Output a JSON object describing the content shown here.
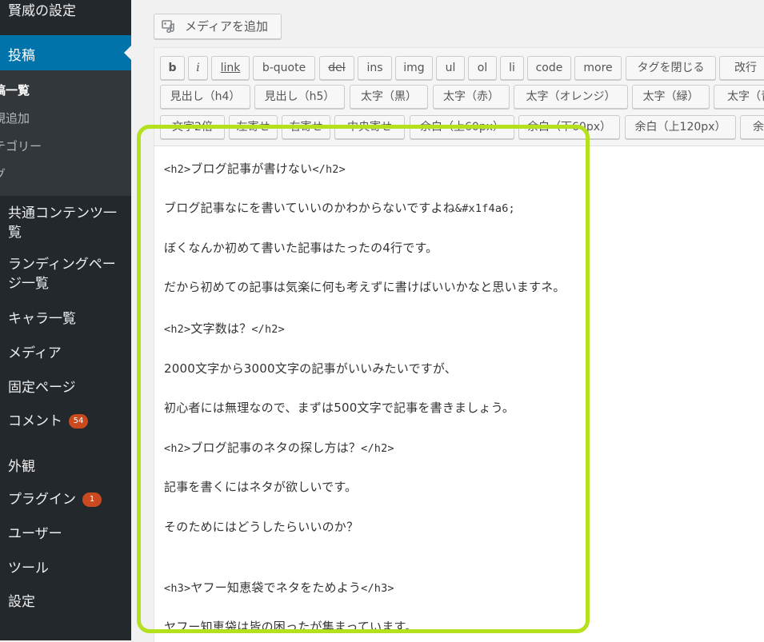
{
  "sidebar": {
    "settings_top": "賢威の設定",
    "posts": "投稿",
    "submenu": [
      "稿一覧",
      "規追加",
      "テゴリー",
      "グ"
    ],
    "items": [
      "共通コンテンツ一覧",
      "ランディングページ一覧",
      "キャラ一覧",
      "メディア",
      "固定ページ",
      "コメント",
      "外観",
      "プラグイン",
      "ユーザー",
      "ツール",
      "設定"
    ],
    "common_line1": "共通コンテンツ一",
    "common_line2": "覧",
    "landing_line1": "ランディングペー",
    "landing_line2": "ジ一覧",
    "comment_badge": "54",
    "plugin_badge": "1"
  },
  "editor": {
    "add_media": "メディアを追加",
    "toolbar_row1": [
      "b",
      "i",
      "link",
      "b-quote",
      "del",
      "ins",
      "img",
      "ul",
      "ol",
      "li",
      "code",
      "more",
      "タグを閉じる",
      "改行（"
    ],
    "toolbar_row2": [
      "見出し（h4）",
      "見出し（h5）",
      "太字（黒）",
      "太字（赤）",
      "太字（オレンジ）",
      "太字（緑）",
      "太字（青"
    ],
    "toolbar_row3": [
      "文字2倍",
      "左寄せ",
      "右寄せ",
      "中央寄せ",
      "余白（上60px）",
      "余白（下60px）",
      "余白（上120px）",
      "余白"
    ],
    "lines": [
      {
        "tag_open": "<h2>",
        "text": "ブログ記事が書けない",
        "tag_close": "</h2>"
      },
      {
        "text": "ブログ記事なにを書いていいのかわからないですよね",
        "entity": "&#x1f4a6;"
      },
      {
        "text": "ぼくなんか初めて書いた記事はたったの4行です。"
      },
      {
        "text": "だから初めての記事は気楽に何も考えずに書けばいいかなと思いますネ。"
      },
      {
        "tag_open": "<h2>",
        "text": "文字数は？",
        "tag_close": "</h2>"
      },
      {
        "text": "2000文字から3000文字の記事がいいみたいですが、"
      },
      {
        "text": "初心者には無理なので、まずは500文字で記事を書きましょう。"
      },
      {
        "tag_open": "<h2>",
        "text": "ブログ記事のネタの探し方は？",
        "tag_close": "</h2>"
      },
      {
        "text": "記事を書くにはネタが欲しいです。"
      },
      {
        "text": "そのためにはどうしたらいいのか？"
      },
      {
        "tag_open": "<h3>",
        "text": "ヤフー知恵袋でネタをためよう",
        "tag_close": "</h3>"
      },
      {
        "text": "ヤフー知恵袋は皆の困ったが集まっています。"
      }
    ]
  },
  "colors": {
    "sidebar_bg": "#23282d",
    "active_bg": "#0073aa",
    "highlight_border": "#b4e01e",
    "badge": "#ca4a1f"
  }
}
